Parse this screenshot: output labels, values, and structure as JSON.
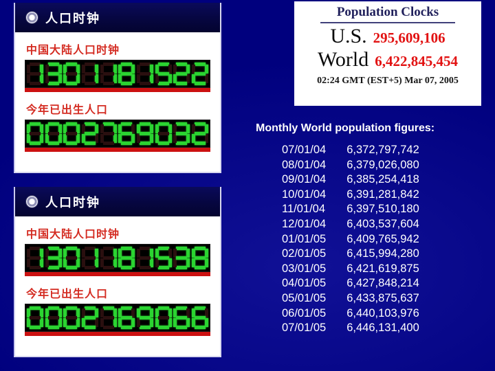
{
  "background_color": "#00007e",
  "clock_panels": [
    {
      "header": {
        "icon": "radio-button-icon",
        "title": "人口时钟"
      },
      "rows": [
        {
          "label": "中国大陆人口时钟",
          "digits": "1301181522"
        },
        {
          "label": "今年已出生人口",
          "digits": "0002769032"
        }
      ]
    },
    {
      "header": {
        "icon": "radio-button-icon",
        "title": "人口时钟"
      },
      "rows": [
        {
          "label": "中国大陆人口时钟",
          "digits": "1301181538"
        },
        {
          "label": "今年已出生人口",
          "digits": "0002769066"
        }
      ]
    }
  ],
  "population_clocks": {
    "title": "Population Clocks",
    "us_label": "U.S.",
    "us_value": "295,609,106",
    "world_label": "World",
    "world_value": "6,422,845,454",
    "timestamp": "02:24 GMT (EST+5) Mar 07, 2005",
    "number_color": "#e21212",
    "title_color": "#21215c"
  },
  "monthly": {
    "heading": "Monthly World population figures:",
    "rows": [
      {
        "date": "07/01/04",
        "value": "6,372,797,742"
      },
      {
        "date": "08/01/04",
        "value": "6,379,026,080"
      },
      {
        "date": "09/01/04",
        "value": "6,385,254,418"
      },
      {
        "date": "10/01/04",
        "value": "6,391,281,842"
      },
      {
        "date": "11/01/04",
        "value": "6,397,510,180"
      },
      {
        "date": "12/01/04",
        "value": "6,403,537,604"
      },
      {
        "date": "01/01/05",
        "value": "6,409,765,942"
      },
      {
        "date": "02/01/05",
        "value": "6,415,994,280"
      },
      {
        "date": "03/01/05",
        "value": "6,421,619,875"
      },
      {
        "date": "04/01/05",
        "value": "6,427,848,214"
      },
      {
        "date": "05/01/05",
        "value": "6,433,875,637"
      },
      {
        "date": "06/01/05",
        "value": "6,440,103,976"
      },
      {
        "date": "07/01/05",
        "value": "6,446,131,400"
      }
    ]
  }
}
